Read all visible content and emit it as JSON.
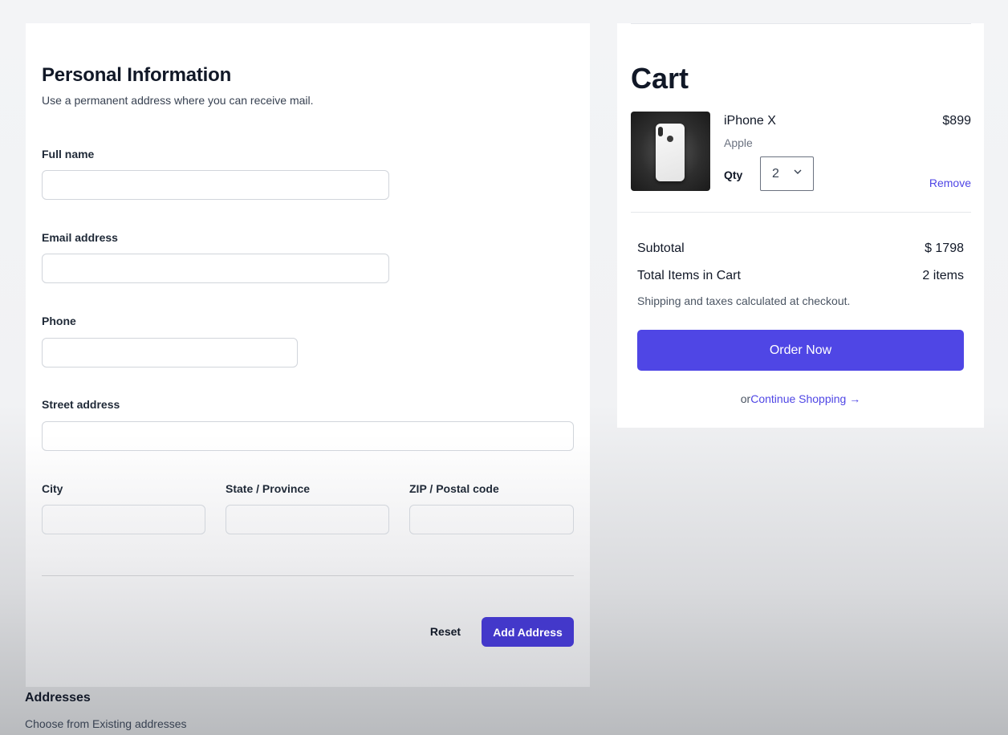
{
  "form": {
    "title": "Personal Information",
    "subtitle": "Use a permanent address where you can receive mail.",
    "full_name": {
      "label": "Full name",
      "value": ""
    },
    "email": {
      "label": "Email address",
      "value": ""
    },
    "phone": {
      "label": "Phone",
      "value": ""
    },
    "street": {
      "label": "Street address",
      "value": ""
    },
    "city": {
      "label": "City",
      "value": ""
    },
    "state": {
      "label": "State / Province",
      "value": ""
    },
    "zip": {
      "label": "ZIP / Postal code",
      "value": ""
    },
    "reset_label": "Reset",
    "add_label": "Add Address"
  },
  "addresses": {
    "title": "Addresses",
    "subtitle": "Choose from Existing addresses"
  },
  "cart": {
    "title": "Cart",
    "item": {
      "name": "iPhone X",
      "brand": "Apple",
      "price": "$899",
      "qty_label": "Qty",
      "qty_value": "2",
      "remove_label": "Remove",
      "image_icon": "iphone-x-image"
    },
    "subtotal_label": "Subtotal",
    "subtotal_value": "$ 1798",
    "total_items_label": "Total Items in Cart",
    "total_items_value": "2 items",
    "shipping_note": "Shipping and taxes calculated at checkout.",
    "order_label": "Order Now",
    "or_text": "or",
    "continue_label": "Continue Shopping →"
  },
  "colors": {
    "primary": "#4f46e5",
    "primary_dark": "#4338ca"
  }
}
